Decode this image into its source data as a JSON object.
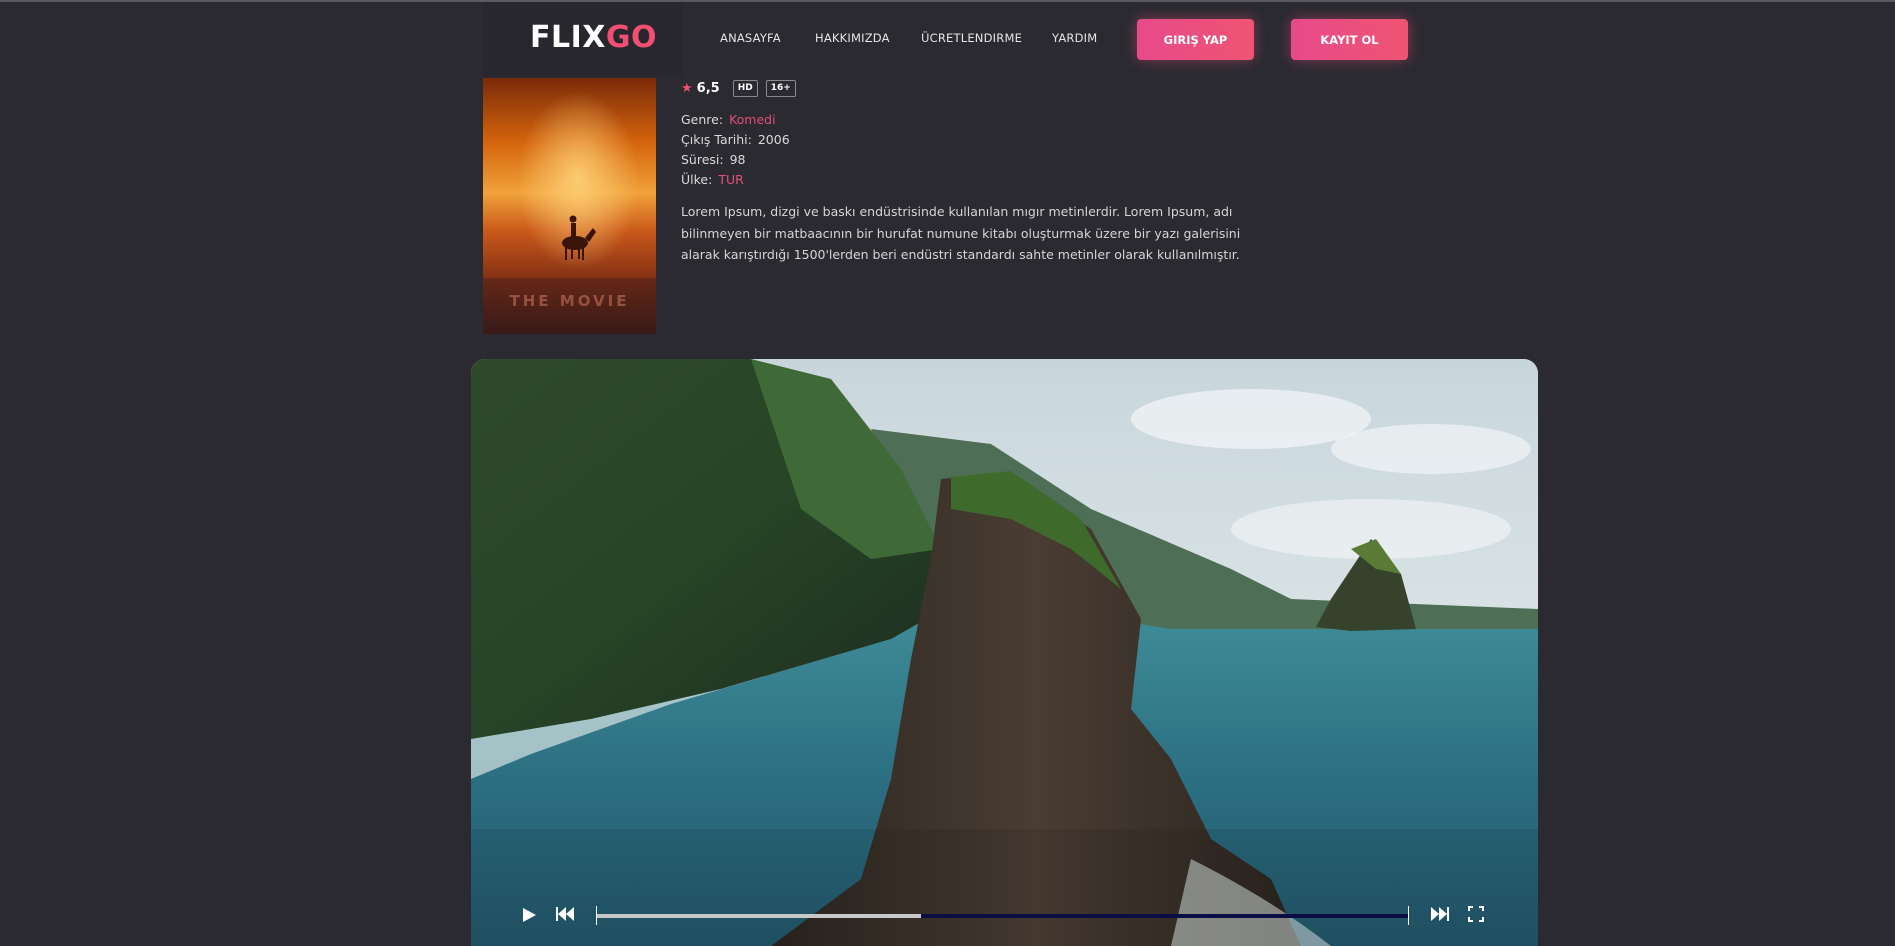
{
  "header": {
    "logo_main": "FLIX",
    "logo_accent": "GO",
    "nav": [
      "ANASAYFA",
      "HAKKIMIZDA",
      "ÜCRETLENDIRME",
      "YARDIM"
    ],
    "login_label": "GIRIŞ YAP",
    "signup_label": "KAYIT OL"
  },
  "movie": {
    "poster_title": "THE MOVIE",
    "rating": "6,5",
    "badges": [
      "HD",
      "16+"
    ],
    "genre_label": "Genre:",
    "genre_value": "Komedi",
    "release_label": "Çıkış Tarihi:",
    "release_value": "2006",
    "duration_label": "Süresi:",
    "duration_value": "98",
    "country_label": "Ülke:",
    "country_value": "TUR",
    "description": "Lorem Ipsum, dizgi ve baskı endüstrisinde kullanılan mıgır metinlerdir. Lorem Ipsum, adı bilinmeyen bir matbaacının bir hurufat numune kitabı oluşturmak üzere bir yazı galerisini alarak karıştırdığı 1500'lerden beri endüstri standardı sahte metinler olarak kullanılmıştır."
  },
  "player": {
    "progress_fraction": 0.4,
    "icons": [
      "play-icon",
      "skip-back-icon",
      "skip-forward-icon",
      "fullscreen-icon"
    ]
  },
  "colors": {
    "background": "#2b2a31",
    "accent": "#f24e74",
    "button_gradient_start": "#e84a8a",
    "button_gradient_end": "#ee5472"
  }
}
